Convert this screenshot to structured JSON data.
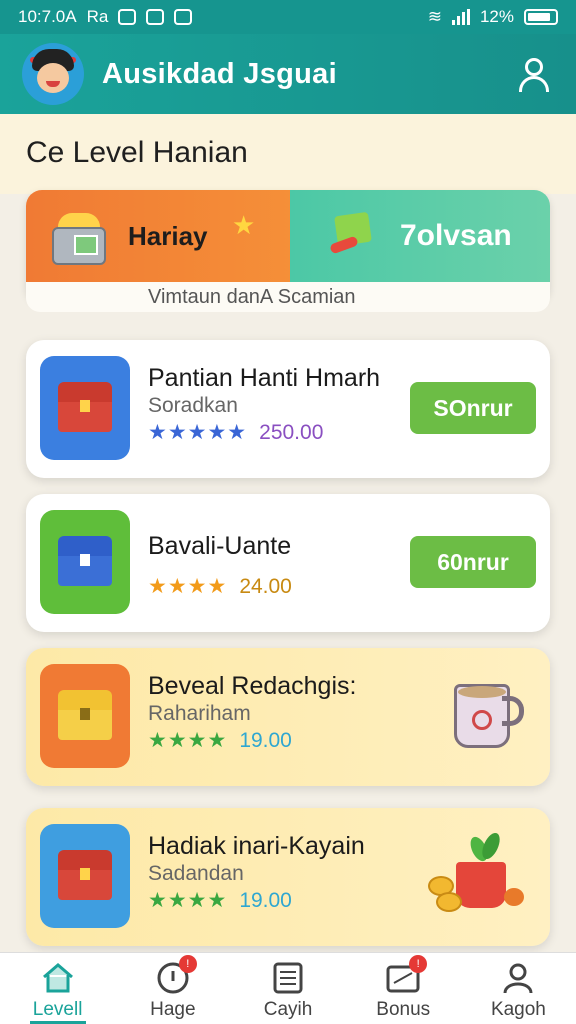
{
  "status_bar": {
    "time": "10:7.0A",
    "carrier": "Ra",
    "battery_percent": "12%"
  },
  "header": {
    "title": "Ausikdad Jsguai",
    "icons": [
      "avatar",
      "profile-icon"
    ]
  },
  "section": {
    "title": "Ce Level Hanian"
  },
  "banner": {
    "left_label": "Hariay",
    "right_label": "7olvsan",
    "caption": "Vimtaun danA   Scamian"
  },
  "cards": [
    {
      "title": "Pantian Hanti Hmarh",
      "subtitle": "Soradkan",
      "stars": "★★★★★",
      "score": "250.00",
      "button": "SOnrur",
      "colors": {
        "icon_bg": "#3b7fe0",
        "score": "#8a4fc1",
        "stars": "#3a66d6"
      }
    },
    {
      "title": "Bavali-Uante",
      "subtitle": "",
      "stars": "★★★★",
      "score": "24.00",
      "button": "60nrur",
      "colors": {
        "icon_bg": "#5fbe3a",
        "score": "#c88a12",
        "stars": "#f29b1a"
      }
    },
    {
      "title": "Beveal Redachgis:",
      "subtitle": "Rahariham",
      "stars": "★★★★",
      "score": "19.00",
      "colors": {
        "icon_bg": "#f07a34",
        "score": "#2fa7d1",
        "stars": "#3aa740"
      }
    },
    {
      "title": "Hadiak inari-Kayain",
      "subtitle": "Sadandan",
      "stars": "★★★★",
      "score": "19.00",
      "colors": {
        "icon_bg": "#3f9ee0",
        "score": "#2fa7d1",
        "stars": "#3aa740"
      }
    }
  ],
  "bottom_nav": [
    {
      "label": "Levell",
      "icon": "home-icon",
      "active": true,
      "badge": ""
    },
    {
      "label": "Hage",
      "icon": "info-icon",
      "active": false,
      "badge": "!"
    },
    {
      "label": "Cayih",
      "icon": "list-icon",
      "active": false,
      "badge": ""
    },
    {
      "label": "Bonus",
      "icon": "gift-icon",
      "active": false,
      "badge": "!"
    },
    {
      "label": "Kagoh",
      "icon": "user-icon",
      "active": false,
      "badge": ""
    }
  ],
  "theme": {
    "header": "#1aa39a",
    "button": "#6cbd45",
    "banner_orange": "#f07a34",
    "banner_green": "#4cc8a6"
  }
}
